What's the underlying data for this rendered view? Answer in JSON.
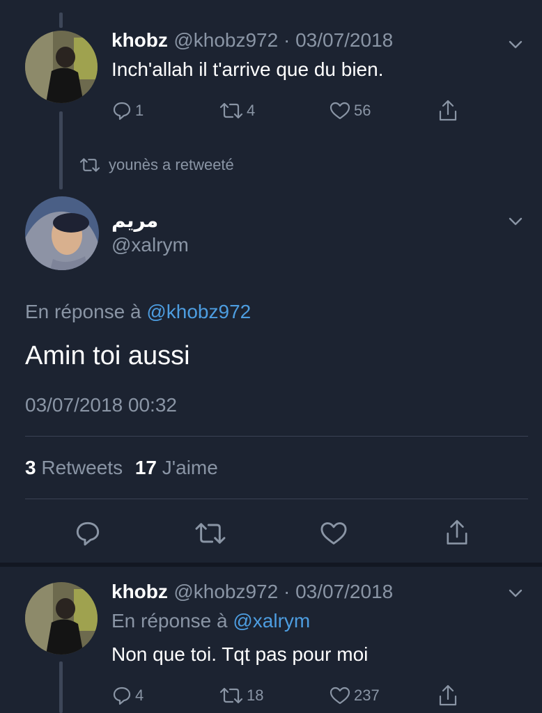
{
  "tweet1": {
    "name": "khobz",
    "meta": "@khobz972 · 03/07/2018",
    "text": "Inch'allah il t'arrive que du bien.",
    "replies": "1",
    "retweets": "4",
    "likes": "56"
  },
  "retweet_notice": "younès a retweeté",
  "main": {
    "name": "مريم",
    "handle": "@xalrym",
    "reply_prefix": "En réponse à",
    "reply_to": "@khobz972",
    "text": "Amin toi aussi",
    "timestamp": "03/07/2018 00:32",
    "retweets_count": "3",
    "retweets_label": "Retweets",
    "likes_count": "17",
    "likes_label": "J'aime"
  },
  "tweet3": {
    "name": "khobz",
    "meta": "@khobz972 · 03/07/2018",
    "reply_prefix": "En réponse à",
    "reply_to": "@xalrym",
    "text": "Non que toi. Tqt pas pour moi",
    "replies": "4",
    "retweets": "18",
    "likes": "237"
  },
  "colors": {
    "background": "#1c2331",
    "muted": "#8a95a5",
    "link": "#4d9de0",
    "divider": "#3a4254"
  }
}
